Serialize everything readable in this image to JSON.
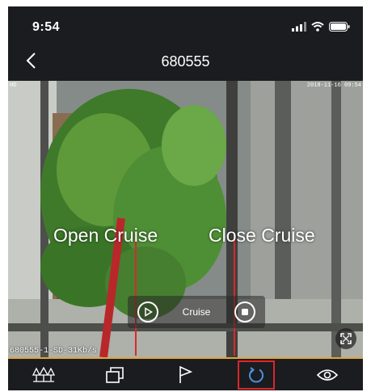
{
  "status_bar": {
    "time": "9:54"
  },
  "nav": {
    "title": "680555",
    "back_icon": "chevron-left-icon"
  },
  "video": {
    "timestamp": "2018-11-16 09:54",
    "quality_tag": "HD",
    "stream_info": "680555-1-SD-31Kb/s"
  },
  "annotations": {
    "open_label": "Open Cruise",
    "close_label": "Close Cruise"
  },
  "cruise_panel": {
    "label": "Cruise",
    "open_icon": "play-circle-icon",
    "close_icon": "stop-circle-icon"
  },
  "toolbar": {
    "items": [
      {
        "icon": "tree-icon"
      },
      {
        "icon": "layers-icon"
      },
      {
        "icon": "flag-icon"
      },
      {
        "icon": "rotate-icon",
        "active": true
      },
      {
        "icon": "eye-icon"
      }
    ]
  },
  "colors": {
    "background": "#1b1c1f",
    "accent": "#e0a53a",
    "highlight": "#d8282c",
    "marker_line": "#d8282c"
  }
}
